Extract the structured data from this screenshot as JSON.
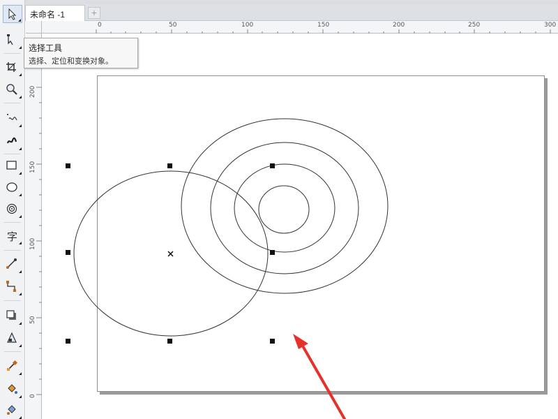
{
  "document_tab": {
    "title": "未命名 -1",
    "add_tab": "+"
  },
  "tooltip": {
    "title": "选择工具",
    "description": "选择、定位和变换对象。"
  },
  "toolbox": {
    "tools": [
      {
        "name": "pick-tool",
        "icon": "arrow-pointer-icon"
      },
      {
        "name": "shape-tool",
        "icon": "shape-node-icon"
      },
      {
        "name": "crop-tool",
        "icon": "crop-icon"
      },
      {
        "name": "zoom-tool",
        "icon": "magnifier-icon"
      },
      {
        "name": "freehand-tool",
        "icon": "freehand-icon"
      },
      {
        "name": "artistic-media-tool",
        "icon": "brush-icon"
      },
      {
        "name": "rectangle-tool",
        "icon": "rectangle-icon"
      },
      {
        "name": "ellipse-tool",
        "icon": "ellipse-icon"
      },
      {
        "name": "polygon-tool",
        "icon": "spiral-icon"
      },
      {
        "name": "text-tool",
        "icon": "text-icon",
        "glyph": "字"
      },
      {
        "name": "parallel-dimension-tool",
        "icon": "dimension-icon"
      },
      {
        "name": "connector-tool",
        "icon": "connector-icon"
      },
      {
        "name": "drop-shadow-tool",
        "icon": "shadow-icon"
      },
      {
        "name": "transparency-tool",
        "icon": "transparency-icon"
      },
      {
        "name": "eyedropper-tool",
        "icon": "eyedropper-icon"
      },
      {
        "name": "interactive-fill-tool",
        "icon": "fill-bucket-icon"
      },
      {
        "name": "smart-fill-tool",
        "icon": "smart-fill-icon"
      }
    ]
  },
  "rulers": {
    "horizontal": [
      "0",
      "50",
      "100",
      "150",
      "200",
      "250",
      "300"
    ],
    "vertical": [
      "200",
      "150",
      "100",
      "50",
      "0"
    ]
  },
  "colors": {
    "annotation_arrow": "#e8302a",
    "outline": "#333333",
    "handle": "#111111"
  }
}
